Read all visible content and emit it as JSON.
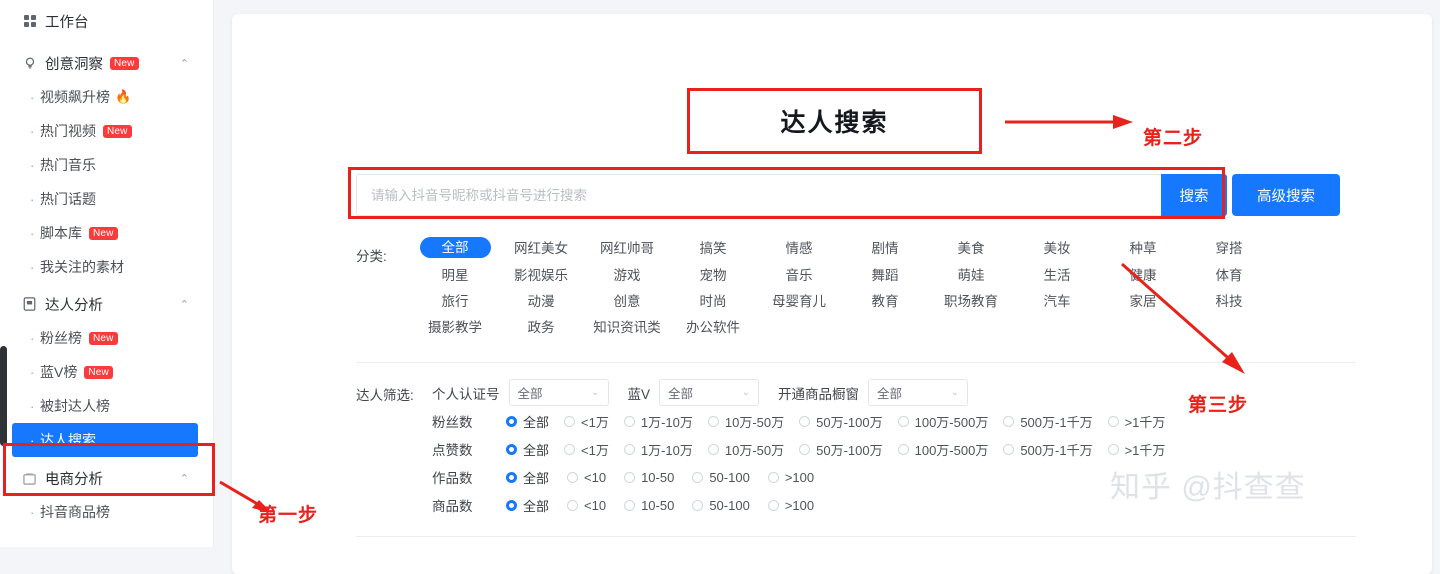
{
  "sidebar": {
    "items": [
      {
        "label": "工作台",
        "icon": "grid-icon",
        "type": "group",
        "badge": null,
        "chevron": false
      },
      {
        "label": "创意洞察",
        "icon": "bulb-icon",
        "type": "group",
        "badge": "New",
        "chevron": true
      },
      {
        "label": "视频飙升榜",
        "type": "sub",
        "badge": null,
        "fire": "🔥"
      },
      {
        "label": "热门视频",
        "type": "sub",
        "badge": "New"
      },
      {
        "label": "热门音乐",
        "type": "sub",
        "badge": null
      },
      {
        "label": "热门话题",
        "type": "sub",
        "badge": null
      },
      {
        "label": "脚本库",
        "type": "sub",
        "badge": "New"
      },
      {
        "label": "我关注的素材",
        "type": "sub",
        "badge": null
      },
      {
        "label": "达人分析",
        "icon": "doc-icon",
        "type": "group",
        "badge": null,
        "chevron": true
      },
      {
        "label": "粉丝榜",
        "type": "sub",
        "badge": "New"
      },
      {
        "label": "蓝V榜",
        "type": "sub",
        "badge": "New"
      },
      {
        "label": "被封达人榜",
        "type": "sub",
        "badge": null
      },
      {
        "label": "达人搜索",
        "type": "sub",
        "badge": null,
        "active": true
      },
      {
        "label": "电商分析",
        "icon": "shop-icon",
        "type": "group",
        "badge": null,
        "chevron": true
      },
      {
        "label": "抖音商品榜",
        "type": "sub",
        "badge": null
      }
    ]
  },
  "main": {
    "title": "达人搜索",
    "search": {
      "placeholder": "请输入抖音号昵称或抖音号进行搜索",
      "value": "",
      "button": "搜索",
      "advanced_button": "高级搜索"
    },
    "category": {
      "label": "分类:",
      "selected": "全部",
      "items": [
        "全部",
        "网红美女",
        "网红帅哥",
        "搞笑",
        "情感",
        "剧情",
        "美食",
        "美妆",
        "种草",
        "穿搭",
        "明星",
        "影视娱乐",
        "游戏",
        "宠物",
        "音乐",
        "舞蹈",
        "萌娃",
        "生活",
        "健康",
        "体育",
        "旅行",
        "动漫",
        "创意",
        "时尚",
        "母婴育儿",
        "教育",
        "职场教育",
        "汽车",
        "家居",
        "科技",
        "摄影教学",
        "政务",
        "知识资讯类",
        "办公软件"
      ]
    },
    "filters": {
      "label": "达人筛选:",
      "selects": [
        {
          "label": "个人认证号",
          "value": "全部"
        },
        {
          "label": "蓝V",
          "value": "全部"
        },
        {
          "label": "开通商品橱窗",
          "value": "全部"
        }
      ],
      "radio_rows": [
        {
          "label": "粉丝数",
          "selected": "全部",
          "options": [
            "全部",
            "<1万",
            "1万-10万",
            "10万-50万",
            "50万-100万",
            "100万-500万",
            "500万-1千万",
            ">1千万"
          ]
        },
        {
          "label": "点赞数",
          "selected": "全部",
          "options": [
            "全部",
            "<1万",
            "1万-10万",
            "10万-50万",
            "50万-100万",
            "100万-500万",
            "500万-1千万",
            ">1千万"
          ]
        },
        {
          "label": "作品数",
          "selected": "全部",
          "options": [
            "全部",
            "<10",
            "10-50",
            "50-100",
            ">100"
          ]
        },
        {
          "label": "商品数",
          "selected": "全部",
          "options": [
            "全部",
            "<10",
            "10-50",
            "50-100",
            ">100"
          ]
        }
      ]
    }
  },
  "annotations": {
    "step1": "第一步",
    "step2": "第二步",
    "step3": "第三步",
    "color": "#e8221b"
  },
  "watermark": "知乎 @抖查查",
  "colors": {
    "accent": "#1677ff",
    "badge": "#fb3b3b",
    "annotation": "#e8221b",
    "page_bg": "#f3f5f8"
  }
}
